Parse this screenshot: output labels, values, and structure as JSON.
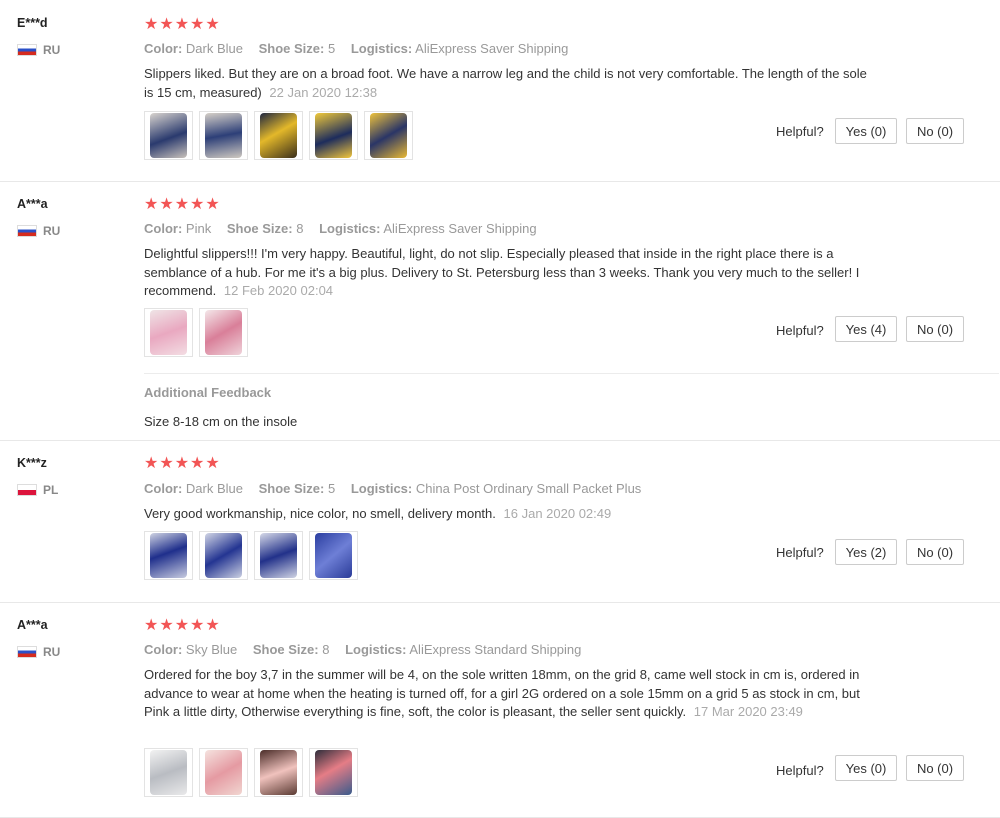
{
  "labels": {
    "color": "Color:",
    "shoe_size": "Shoe Size:",
    "logistics": "Logistics:",
    "helpful": "Helpful?",
    "additional_feedback": "Additional Feedback"
  },
  "star_color": "#f25555",
  "reviews": [
    {
      "user": "E***d",
      "country": "RU",
      "rating": 5,
      "color": "Dark Blue",
      "shoe_size": "5",
      "logistics": "AliExpress Saver Shipping",
      "text": "Slippers liked. But they are on a broad foot. We have a narrow leg and the child is not very comfortable. The length of the sole is 15 cm, measured)",
      "date": "22 Jan 2020 12:38",
      "photos": 5,
      "yes": "Yes (0)",
      "no": "No (0)"
    },
    {
      "user": "A***a",
      "country": "RU",
      "rating": 5,
      "color": "Pink",
      "shoe_size": "8",
      "logistics": "AliExpress Saver Shipping",
      "text": "Delightful slippers!!! I'm very happy. Beautiful, light, do not slip. Especially pleased that inside in the right place there is a semblance of a hub. For me it's a big plus. Delivery to St. Petersburg less than 3 weeks. Thank you very much to the seller! I recommend.",
      "date": "12 Feb 2020 02:04",
      "photos": 2,
      "yes": "Yes (4)",
      "no": "No (0)",
      "additional_feedback": "Size 8-18 cm on the insole"
    },
    {
      "user": "K***z",
      "country": "PL",
      "rating": 5,
      "color": "Dark Blue",
      "shoe_size": "5",
      "logistics": "China Post Ordinary Small Packet Plus",
      "text": "Very good workmanship, nice color, no smell, delivery month.",
      "date": "16 Jan 2020 02:49",
      "photos": 4,
      "yes": "Yes (2)",
      "no": "No (0)"
    },
    {
      "user": "A***a",
      "country": "RU",
      "rating": 5,
      "color": "Sky Blue",
      "shoe_size": "8",
      "logistics": "AliExpress Standard Shipping",
      "text": "Ordered for the boy 3,7 in the summer will be 4, on the sole written 18mm, on the grid 8, came well stock in cm is, ordered in advance to wear at home when the heating is turned off, for a girl 2G ordered on a sole 15mm on a grid 5 as stock in cm, but Pink a little dirty, Otherwise everything is fine, soft, the color is pleasant, the seller sent quickly.",
      "date": "17 Mar 2020 23:49",
      "photos": 4,
      "yes": "Yes (0)",
      "no": "No (0)"
    }
  ]
}
